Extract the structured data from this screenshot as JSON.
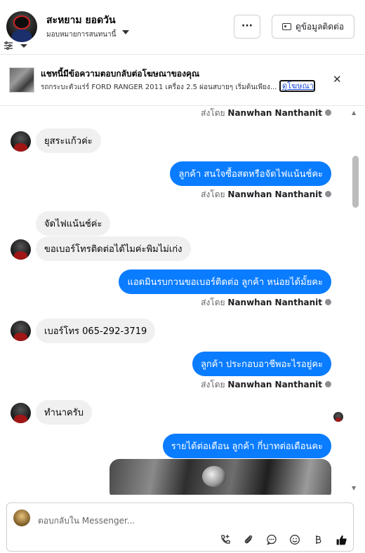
{
  "header": {
    "name": "สะหยาม ยอดวัน",
    "assign_label": "มอบหมายการสนทนานี้",
    "more_label": "···",
    "contact_button": "ดูข้อมูลติดต่อ"
  },
  "ad_banner": {
    "title": "แชทนี้มีข้อความตอบกลับต่อโฆษณาของคุณ",
    "description": "รถกระบะตัวแร่ร์ FORD RANGER 2011 เครื่อง 2.5 ผ่อนสบายๆ เริ่มต้นเพียง...",
    "link_label": "ดูโฆษณา",
    "close_label": "✕"
  },
  "messages": {
    "sent_by_prefix": "ส่งโดย",
    "sender_name": "Nanwhan Nanthanit",
    "m1": "ยุสระแก้วค่ะ",
    "m2": "ลูกค้า สนใจซื้อสดหรือจัดไฟแน้นช์คะ",
    "m3": "จัดไฟแน้นช์ค่ะ",
    "m4": "ขอเบอร์โทรติดต่อได้ไมค่ะพิมไม่เก่ง",
    "m5": "แอดมินรบกวนขอเบอร์ติดต่อ ลูกค้า หน่อยได้มั้ยคะ",
    "m6": "เบอร์โทร 065-292-3719",
    "m7": "ลูกค้า ประกอบอาชีพอะไรอยู่คะ",
    "m8": "ทำนาครับ",
    "m9": "รายได้ต่อเดือน ลูกค้า กี่บาทต่อเดือนคะ"
  },
  "composer": {
    "placeholder": "ตอบกลับใน Messenger..."
  }
}
